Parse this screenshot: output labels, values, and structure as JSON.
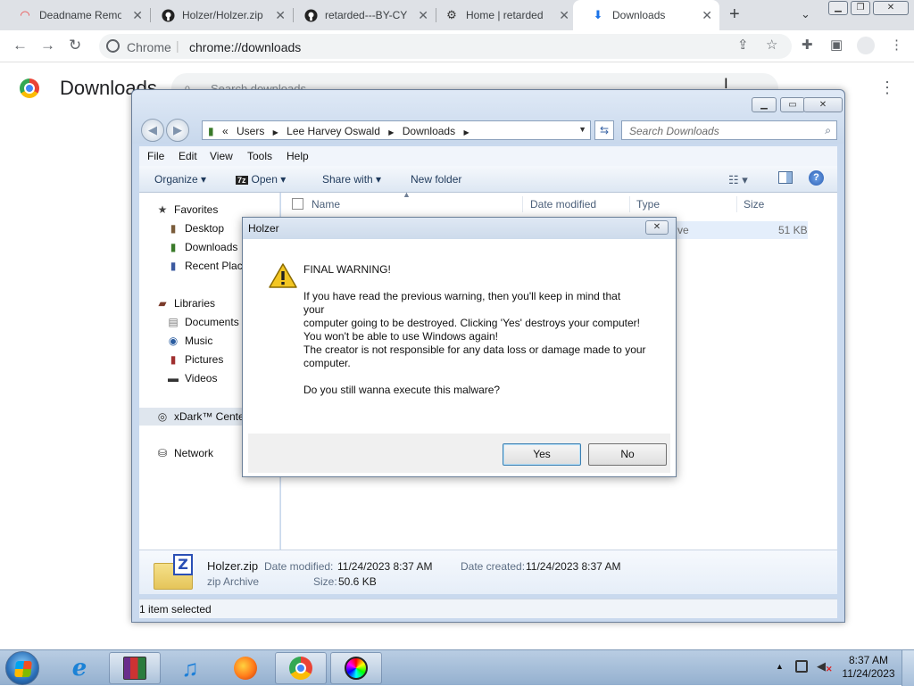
{
  "browser": {
    "tabs": [
      {
        "title": "Deadname Remo",
        "icon": "rainbow-icon"
      },
      {
        "title": "Holzer/Holzer.zip",
        "icon": "github-icon"
      },
      {
        "title": "retarded---BY-CY",
        "icon": "github-icon"
      },
      {
        "title": "Home | retarded",
        "icon": "site-icon"
      },
      {
        "title": "Downloads",
        "icon": "download-icon",
        "active": true
      }
    ],
    "new_tab_glyph": "+",
    "omnibox_origin": "Chrome",
    "omnibox_divider": "|",
    "omnibox_url": "chrome://downloads"
  },
  "downloads_page": {
    "title": "Downloads",
    "search_placeholder": "Search downloads"
  },
  "explorer": {
    "breadcrumb": [
      "«",
      "Users",
      "Lee Harvey Oswald",
      "Downloads"
    ],
    "search_placeholder": "Search Downloads",
    "menu": [
      "File",
      "Edit",
      "View",
      "Tools",
      "Help"
    ],
    "commands": {
      "organize": "Organize",
      "open": "Open",
      "open_badge": "7z",
      "share_with": "Share with",
      "new_folder": "New folder"
    },
    "nav": {
      "favorites": "Favorites",
      "desktop": "Desktop",
      "downloads": "Downloads",
      "recent_places": "Recent Place",
      "libraries": "Libraries",
      "documents": "Documents",
      "music": "Music",
      "pictures": "Pictures",
      "videos": "Videos",
      "xdark": "xDark™ Center",
      "network": "Network"
    },
    "columns": {
      "name": "Name",
      "date_modified": "Date modified",
      "type": "Type",
      "size": "Size"
    },
    "file_row": {
      "type_partial": "ve",
      "size": "51 KB"
    },
    "details": {
      "filename": "Holzer.zip",
      "filetype": "zip Archive",
      "date_modified_label": "Date modified:",
      "date_modified": "11/24/2023 8:37 AM",
      "date_created_label": "Date created:",
      "date_created": "11/24/2023 8:37 AM",
      "size_label": "Size:",
      "size": "50.6 KB"
    },
    "status": "1 item selected"
  },
  "dialog": {
    "title": "Holzer",
    "lines": [
      "FINAL WARNING!",
      "",
      "If you have read the previous warning, then you'll keep in mind that",
      "your",
      "computer going to be destroyed. Clicking 'Yes' destroys your computer!",
      "You won't be able to use Windows again!",
      "The creator is not responsible for any data loss or damage made to your",
      "computer.",
      "",
      "Do you still wanna execute this malware?"
    ],
    "yes_label": "Yes",
    "no_label": "No"
  },
  "taskbar": {
    "apps": [
      "internet-explorer-icon",
      "winrar-icon",
      "itunes-icon",
      "firefox-icon",
      "chrome-icon",
      "xdark-icon"
    ],
    "clock_time": "8:37 AM",
    "clock_date": "11/24/2023"
  }
}
